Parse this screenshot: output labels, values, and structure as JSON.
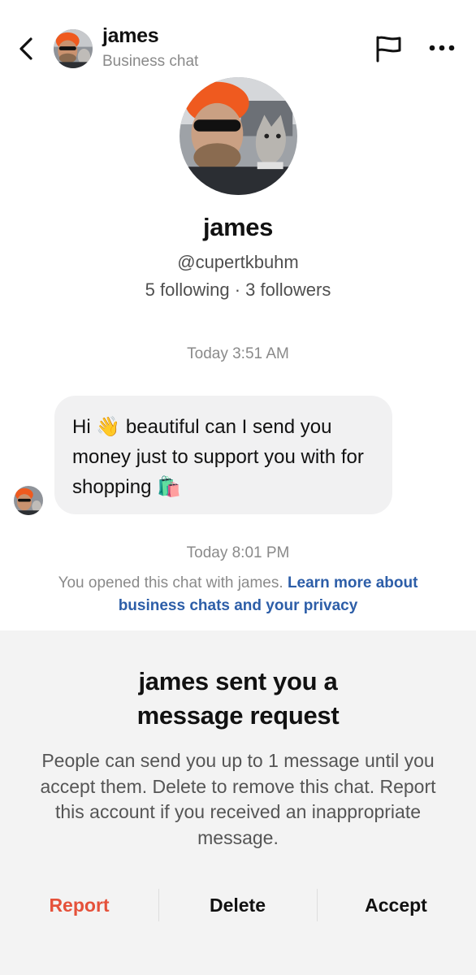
{
  "header": {
    "name": "james",
    "subtitle": "Business chat",
    "back_icon": "chevron-left-icon",
    "flag_icon": "flag-icon",
    "more_icon": "more-horizontal-icon"
  },
  "profile": {
    "name": "james",
    "handle": "@cupertkbuhm",
    "stats": "5 following · 3 followers"
  },
  "conversation": {
    "timestamp_1": "Today 3:51 AM",
    "message": {
      "part1": "Hi ",
      "emoji1": "👋",
      "part2": " beautiful can I send you money just to support you with for shopping ",
      "emoji2": "🛍️"
    },
    "timestamp_2": "Today 8:01 PM",
    "notice_text": "You opened this chat with james. ",
    "notice_link": "Learn more about business chats and your privacy"
  },
  "request_panel": {
    "title_line1": "james sent you a",
    "title_line2": "message request",
    "body": "People can send you up to 1 message until you accept them. Delete to remove this chat. Report this account if you received an inappropriate message.",
    "report_label": "Report",
    "delete_label": "Delete",
    "accept_label": "Accept"
  },
  "colors": {
    "report": "#e5513a",
    "link": "#2d5ea8",
    "bubble": "#f1f1f2",
    "panel": "#f3f3f3",
    "muted": "#8a8a8a"
  }
}
